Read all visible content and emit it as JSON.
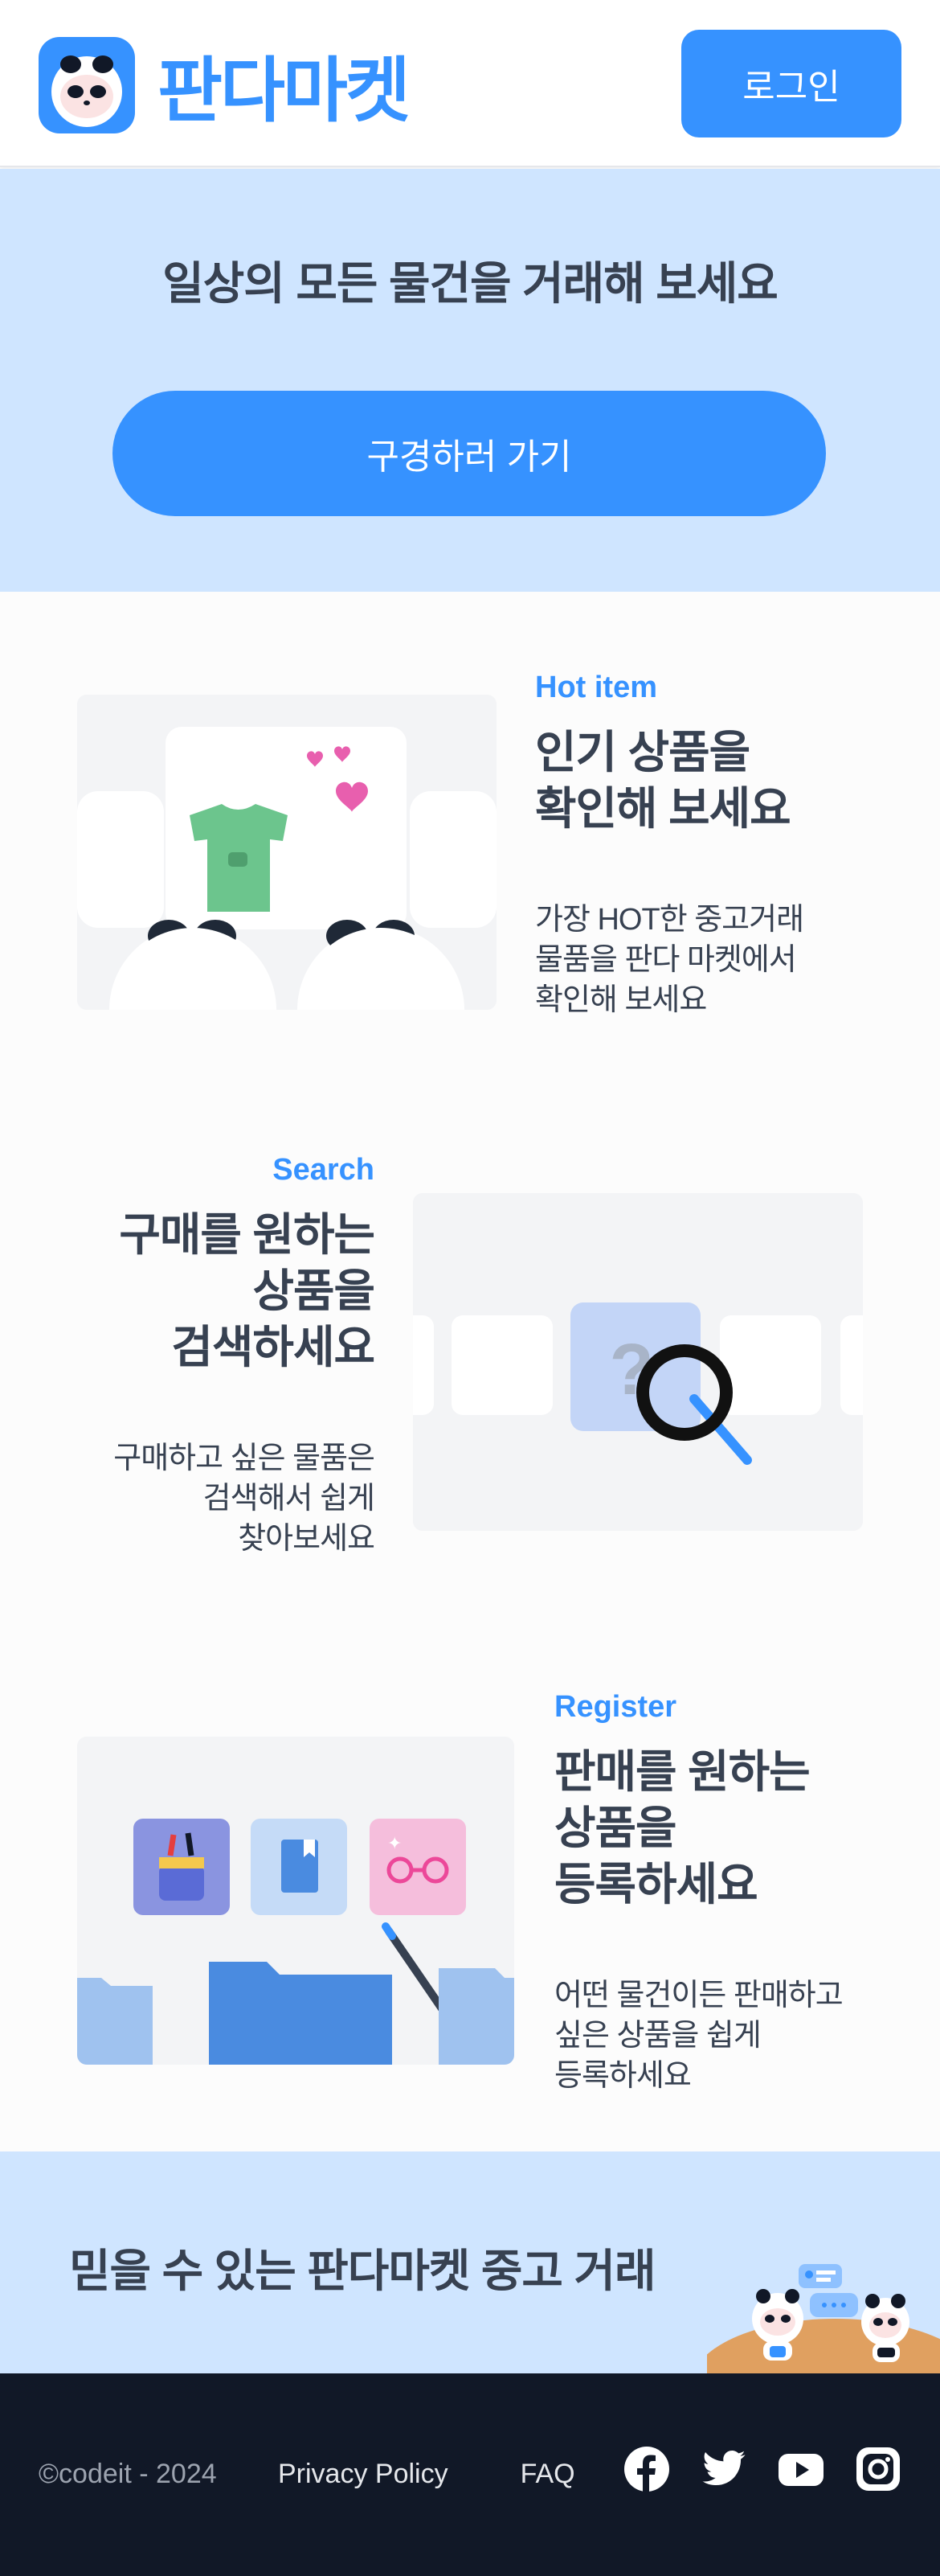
{
  "header": {
    "logo_text": "판다마켓",
    "login_label": "로그인"
  },
  "hero": {
    "title": "일상의 모든 물건을 거래해 보세요",
    "cta_label": "구경하러 가기"
  },
  "features": [
    {
      "tag": "Hot item",
      "title_lines": [
        "인기 상품을",
        "확인해 보세요"
      ],
      "desc_lines": [
        "가장 HOT한 중고거래",
        "물품을 판다 마켓에서",
        "확인해 보세요"
      ]
    },
    {
      "tag": "Search",
      "title_lines": [
        "구매를 원하는",
        "상품을",
        "검색하세요"
      ],
      "desc_lines": [
        "구매하고 싶은 물품은",
        "검색해서 쉽게",
        "찾아보세요"
      ]
    },
    {
      "tag": "Register",
      "title_lines": [
        "판매를 원하는",
        "상품을",
        "등록하세요"
      ],
      "desc_lines": [
        "어떤 물건이든 판매하고",
        "싶은 상품을 쉽게",
        "등록하세요"
      ]
    }
  ],
  "banner": {
    "title": "믿을 수 있는 판다마켓 중고 거래"
  },
  "footer": {
    "copyright": "©codeit - 2024",
    "links": [
      "Privacy Policy",
      "FAQ"
    ],
    "social_icons": [
      "facebook-icon",
      "twitter-icon",
      "youtube-icon",
      "instagram-icon"
    ]
  },
  "colors": {
    "brand": "#3692ff",
    "hero_bg": "#cfe5ff",
    "footer_bg": "#111827"
  }
}
